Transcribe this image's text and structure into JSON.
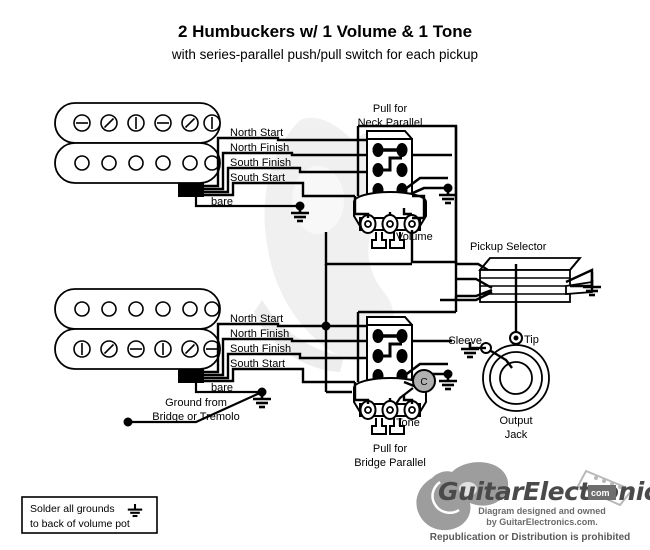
{
  "header": {
    "title": "2 Humbuckers w/ 1 Volume & 1 Tone",
    "subtitle": "with series-parallel push/pull switch for each pickup"
  },
  "pickups": {
    "neck": {
      "name": "neck-humbucker",
      "wires": [
        "North Start",
        "North Finish",
        "South Finish",
        "South Start"
      ],
      "bare_label": "bare"
    },
    "bridge": {
      "name": "bridge-humbucker",
      "wires": [
        "North Start",
        "North Finish",
        "South Finish",
        "South Start"
      ],
      "bare_label": "bare",
      "ground_note_line1": "Ground from",
      "ground_note_line2": "Bridge or Tremolo"
    }
  },
  "controls": {
    "volume": {
      "label": "Volume",
      "pull_line1": "Pull for",
      "pull_line2": "Neck Parallel"
    },
    "tone": {
      "label": "Tone",
      "pull_line1": "Pull for",
      "pull_line2": "Bridge Parallel",
      "cap_label": "C"
    },
    "selector": {
      "label": "Pickup Selector"
    },
    "jack": {
      "sleeve_label": "Sleeve",
      "tip_label": "Tip",
      "name_line1": "Output",
      "name_line2": "Jack"
    }
  },
  "notes": {
    "solder_line1": "Solder all grounds",
    "solder_line2": "to back of volume pot"
  },
  "branding": {
    "logo_text": "GuitarElectronics",
    "logo_suffix": "com",
    "credit_line1": "Diagram designed and owned",
    "credit_line2": "by GuitarElectronics.com.",
    "credit_line3": "Republication or Distribution is prohibited"
  },
  "colors": {
    "ink": "#000000",
    "paper": "#ffffff",
    "cap": "#b0b0b0",
    "logo": "#4a4a4a"
  }
}
